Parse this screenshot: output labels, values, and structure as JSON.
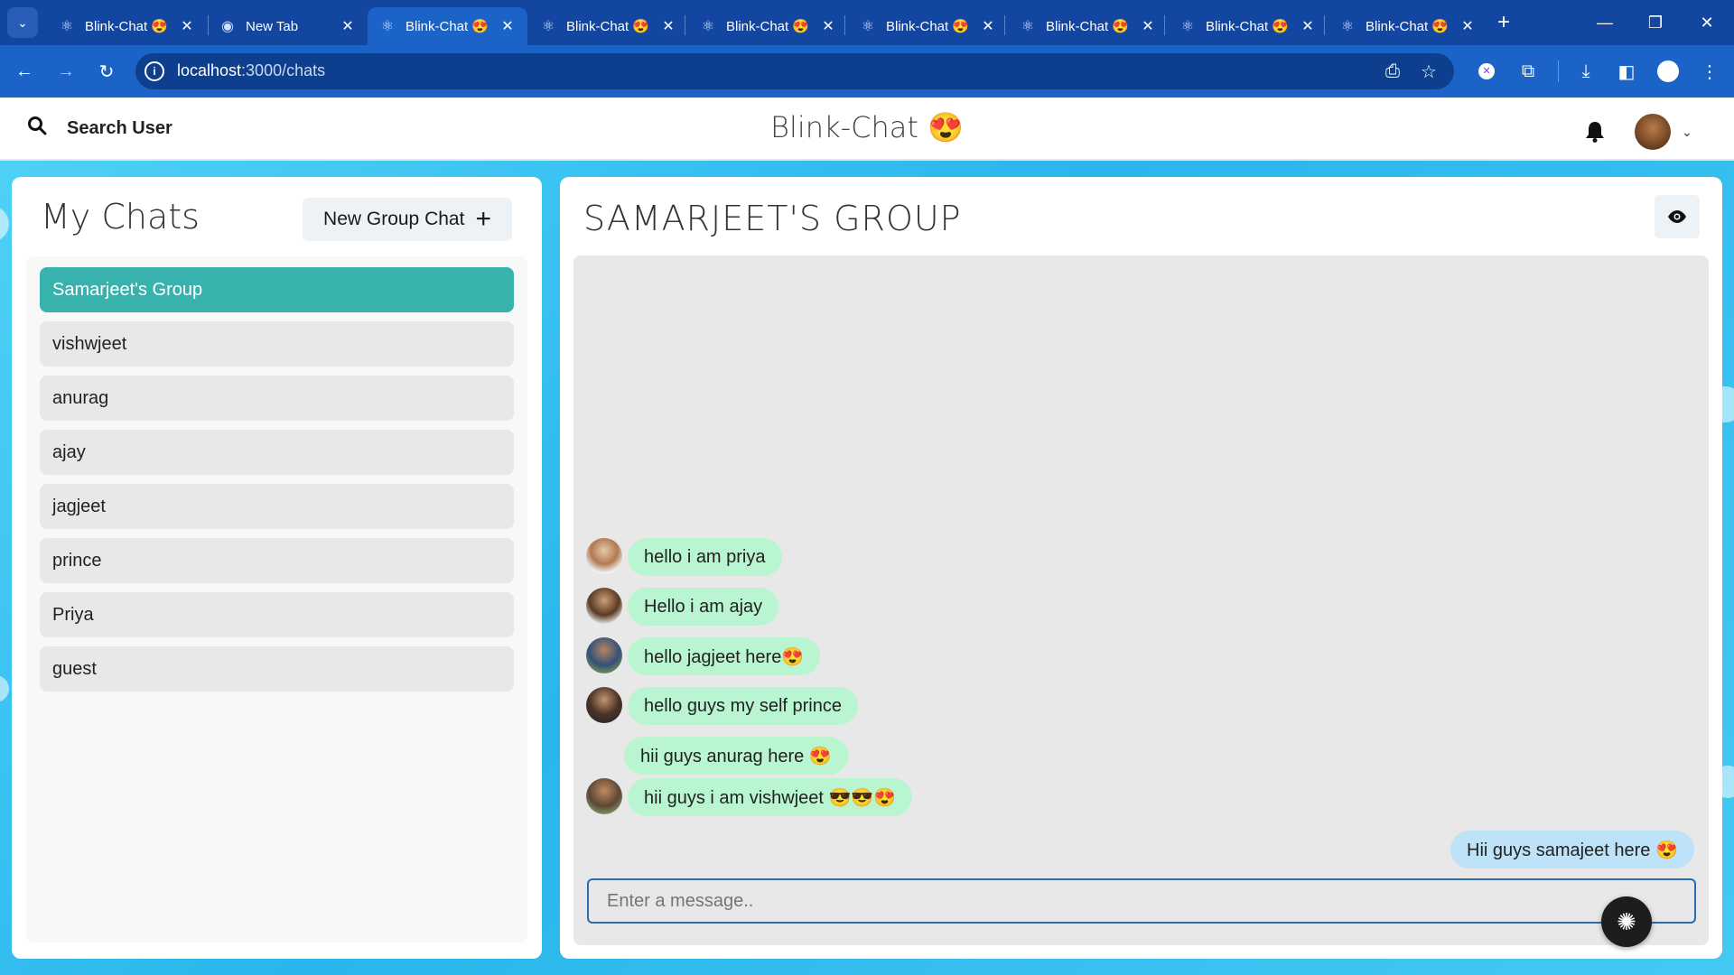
{
  "browser": {
    "tabs": [
      {
        "title": "Blink-Chat 😍",
        "icon": "react-icon",
        "active": false
      },
      {
        "title": "New Tab",
        "icon": "chrome-icon",
        "active": false
      },
      {
        "title": "Blink-Chat 😍",
        "icon": "react-icon",
        "active": true
      },
      {
        "title": "Blink-Chat 😍",
        "icon": "react-icon",
        "active": false
      },
      {
        "title": "Blink-Chat 😍",
        "icon": "react-icon",
        "active": false
      },
      {
        "title": "Blink-Chat 😍",
        "icon": "react-icon",
        "active": false
      },
      {
        "title": "Blink-Chat 😍",
        "icon": "react-icon",
        "active": false
      },
      {
        "title": "Blink-Chat 😍",
        "icon": "react-icon",
        "active": false
      },
      {
        "title": "Blink-Chat 😍",
        "icon": "react-icon",
        "active": false
      }
    ],
    "url_host": "localhost",
    "url_path": ":3000/chats"
  },
  "header": {
    "search_label": "Search User",
    "brand": "Blink-Chat 😍"
  },
  "sidebar": {
    "title": "My Chats",
    "new_group_label": "New Group Chat",
    "chats": [
      {
        "name": "Samarjeet's Group",
        "selected": true
      },
      {
        "name": "vishwjeet",
        "selected": false
      },
      {
        "name": "anurag",
        "selected": false
      },
      {
        "name": "ajay",
        "selected": false
      },
      {
        "name": "jagjeet",
        "selected": false
      },
      {
        "name": "prince",
        "selected": false
      },
      {
        "name": "Priya",
        "selected": false
      },
      {
        "name": "guest",
        "selected": false
      }
    ]
  },
  "conversation": {
    "title": "SAMARJEET'S GROUP",
    "messages": [
      {
        "text": "hello i am priya",
        "sender_avatar": true,
        "mine": false
      },
      {
        "text": "Hello i am ajay",
        "sender_avatar": true,
        "mine": false
      },
      {
        "text": "hello jagjeet here😍",
        "sender_avatar": true,
        "mine": false
      },
      {
        "text": "hello guys my self prince",
        "sender_avatar": true,
        "mine": false
      },
      {
        "text": "hii guys anurag here 😍",
        "sender_avatar": false,
        "mine": false
      },
      {
        "text": "hii guys i am vishwjeet 😎😎😍",
        "sender_avatar": true,
        "mine": false
      },
      {
        "text": "Hii guys samajeet here 😍",
        "sender_avatar": false,
        "mine": true
      }
    ],
    "input_placeholder": "Enter a message.."
  },
  "colors": {
    "selected_chat": "#38b2ac",
    "incoming_bubble": "#b9f5d0",
    "outgoing_bubble": "#bee3f8",
    "browser_frame": "#1c63c7"
  }
}
